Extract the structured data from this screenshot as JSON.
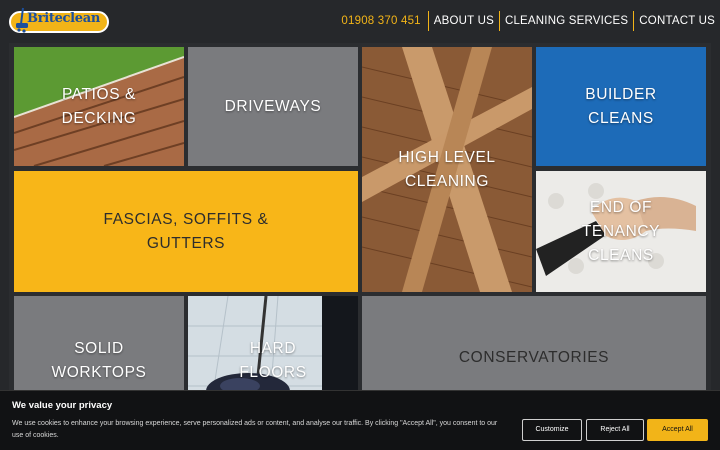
{
  "brand": {
    "name": "Briteclean"
  },
  "nav": {
    "phone": "01908 370 451",
    "items": [
      "ABOUT US",
      "CLEANING SERVICES",
      "CONTACT US"
    ]
  },
  "tiles": [
    {
      "label_lines": [
        "PATIOS &",
        "DECKING"
      ]
    },
    {
      "label_lines": [
        "DRIVEWAYS"
      ]
    },
    {
      "label_lines": [
        "HIGH LEVEL",
        "CLEANING"
      ]
    },
    {
      "label_lines": [
        "BUILDER",
        "CLEANS"
      ]
    },
    {
      "label_lines": [
        "FASCIAS, SOFFITS &",
        "GUTTERS"
      ]
    },
    {
      "label_lines": [
        "END OF",
        "TENANCY",
        "CLEANS"
      ]
    },
    {
      "label_lines": [
        "SOLID",
        "WORKTOPS"
      ]
    },
    {
      "label_lines": [
        "HARD",
        "FLOORS"
      ]
    },
    {
      "label_lines": [
        "CONSERVATORIES"
      ]
    }
  ],
  "cookie": {
    "title": "We value your privacy",
    "text": "We use cookies to enhance your browsing experience, serve personalized ads or content, and analyse our traffic. By clicking \"Accept All\", you consent to our use of cookies.",
    "buttons": {
      "customize": "Customize",
      "reject": "Reject All",
      "accept": "Accept All"
    }
  },
  "colors": {
    "brand_yellow": "#f2b418",
    "tile_blue": "#1d6bb8",
    "tile_grey": "#7a7b7e",
    "header_bg": "#26282b"
  }
}
